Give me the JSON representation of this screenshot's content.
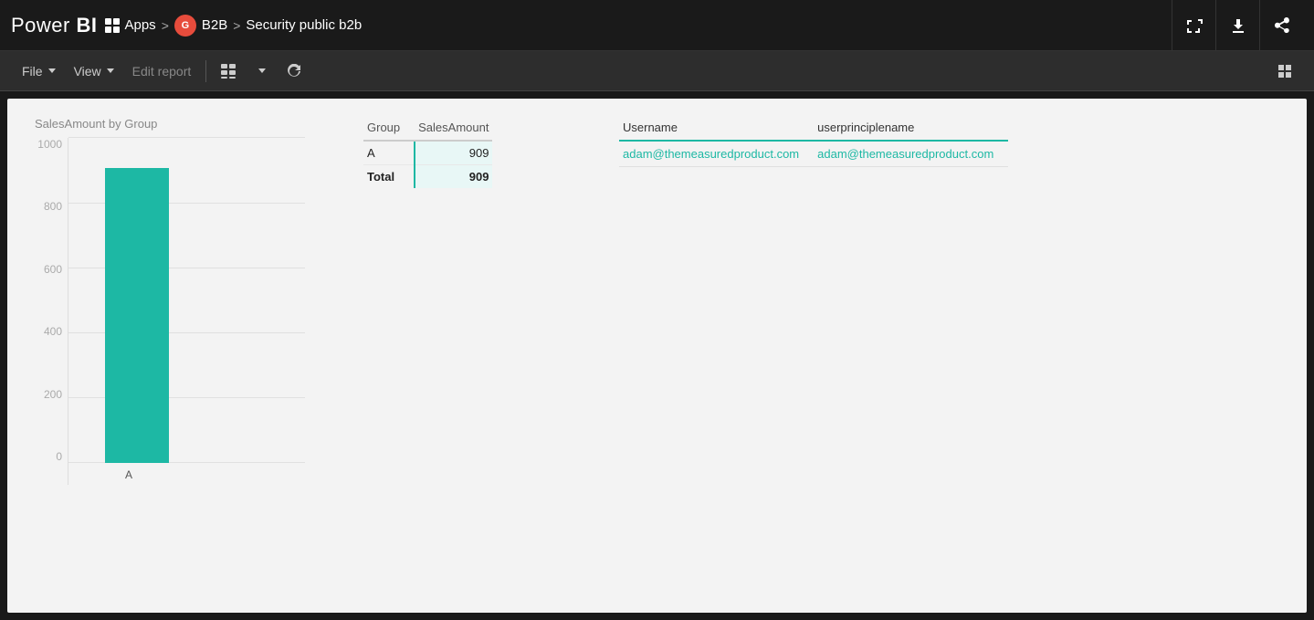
{
  "topbar": {
    "logo": "Power BI",
    "breadcrumb": {
      "apps_label": "Apps",
      "b2b_initial": "G",
      "b2b_label": "B2B",
      "page_label": "Security public b2b",
      "separator": ">"
    }
  },
  "toolbar": {
    "file_label": "File",
    "view_label": "View",
    "edit_report_label": "Edit report",
    "chevron_label": "▾"
  },
  "chart": {
    "title": "SalesAmount by Group",
    "y_labels": [
      "0",
      "200",
      "400",
      "600",
      "800",
      "1000"
    ],
    "bar_value": 909,
    "bar_max": 1000,
    "x_label": "A"
  },
  "sales_table": {
    "col_group": "Group",
    "col_amount": "SalesAmount",
    "rows": [
      {
        "group": "A",
        "amount": "909"
      }
    ],
    "total_label": "Total",
    "total_value": "909"
  },
  "user_table": {
    "col_username": "Username",
    "col_upn": "userprinciplename",
    "rows": [
      {
        "username": "adam@themeasuredproduct.com",
        "upn": "adam@themeasuredproduct.com"
      }
    ]
  },
  "icons": {
    "expand": "⤢",
    "download": "⬇",
    "share": "⎘",
    "refresh": "↻"
  }
}
